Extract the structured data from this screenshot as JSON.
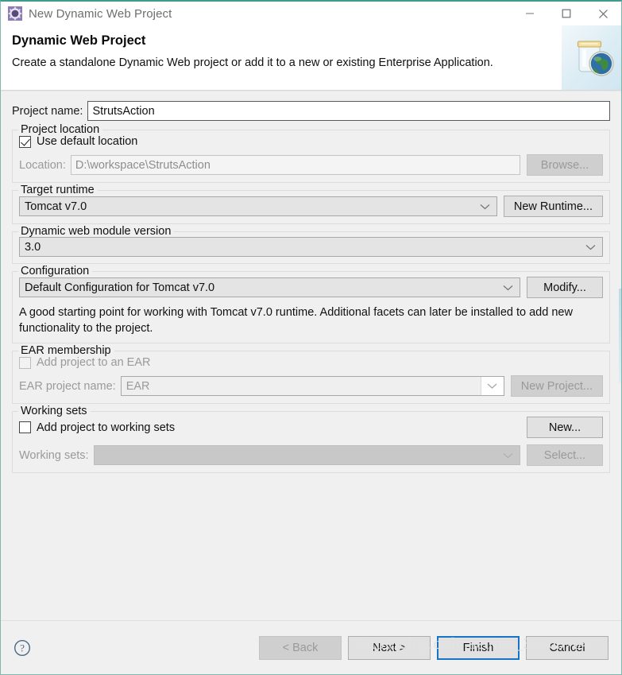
{
  "window": {
    "title": "New Dynamic Web Project",
    "icon": "eclipse-gear-icon",
    "minimize_label": "—",
    "maximize_label": "□",
    "close_label": "✕"
  },
  "header": {
    "title": "Dynamic Web Project",
    "description": "Create a standalone Dynamic Web project or add it to a new or existing Enterprise Application.",
    "icon": "web-project-jar-globe-icon"
  },
  "project_name": {
    "label": "Project name:",
    "value": "StrutsAction"
  },
  "project_location": {
    "legend": "Project location",
    "use_default_label": "Use default location",
    "use_default_checked": true,
    "location_label": "Location:",
    "location_value": "D:\\workspace\\StrutsAction",
    "browse_label": "Browse..."
  },
  "target_runtime": {
    "legend": "Target runtime",
    "value": "Tomcat v7.0",
    "new_runtime_label": "New Runtime..."
  },
  "module_version": {
    "legend": "Dynamic web module version",
    "value": "3.0"
  },
  "configuration": {
    "legend": "Configuration",
    "value": "Default Configuration for Tomcat v7.0",
    "modify_label": "Modify...",
    "description": "A good starting point for working with Tomcat v7.0 runtime. Additional facets can later be installed to add new functionality to the project."
  },
  "ear_membership": {
    "legend": "EAR membership",
    "add_to_ear_label": "Add project to an EAR",
    "add_to_ear_checked": false,
    "ear_project_label": "EAR project name:",
    "ear_project_value": "EAR",
    "new_project_label": "New Project..."
  },
  "working_sets": {
    "legend": "Working sets",
    "add_to_working_sets_label": "Add project to working sets",
    "add_to_working_sets_checked": false,
    "working_sets_label": "Working sets:",
    "working_sets_value": "",
    "new_label": "New...",
    "select_label": "Select..."
  },
  "footer": {
    "help_icon": "help-question-icon",
    "back_label": "< Back",
    "next_label": "Next >",
    "finish_label": "Finish",
    "cancel_label": "Cancel",
    "watermark": "http://blog.csdn.net/m0_37769704"
  },
  "colors": {
    "window_border": "#3f9b8c",
    "default_button_outline": "#1673c8",
    "body_background": "#f0f0f0",
    "disabled_text": "#9a9a9a"
  }
}
